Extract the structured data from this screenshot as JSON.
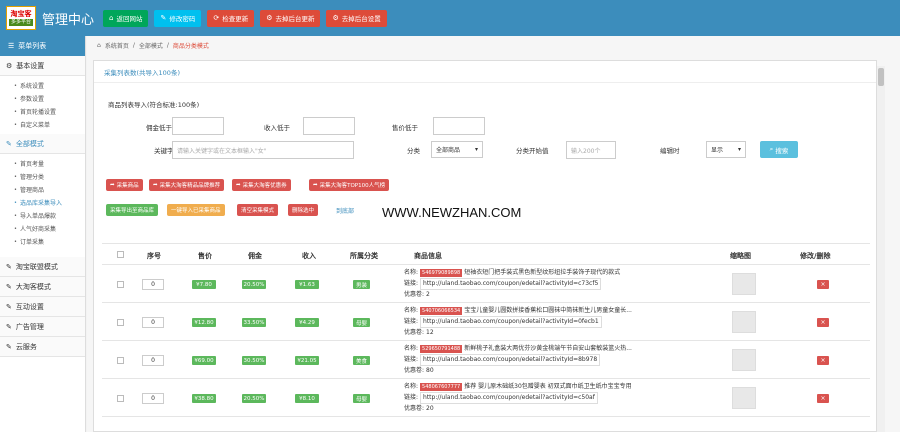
{
  "logo": {
    "line1": "淘宝客",
    "line2": "多多平台"
  },
  "header": {
    "title": "管理中心",
    "buttons": [
      {
        "label": "返回网站",
        "icon": "home-icon",
        "color": "#00a65a"
      },
      {
        "label": "修改密码",
        "icon": "pencil-icon",
        "color": "#00c0ef"
      },
      {
        "label": "检查更新",
        "icon": "refresh-icon",
        "color": "#dd4b39"
      },
      {
        "label": "去掉后台更新",
        "icon": "gear-icon",
        "color": "#dd4b39"
      },
      {
        "label": "去掉后台设置",
        "icon": "gear-icon",
        "color": "#dd4b39"
      }
    ]
  },
  "sidebar": {
    "head": "菜单列表",
    "sections": [
      {
        "label": "基本设置",
        "icon": "cog-icon",
        "items": [
          "系统设置",
          "参数设置",
          "首页轮播设置",
          "自定义菜单"
        ]
      },
      {
        "label": "全部模式",
        "icon": "edit-icon",
        "active": true,
        "items": [
          "首页考量",
          "管理分类",
          "管理商品",
          "选品库采集导入",
          "导入单品爆款",
          "人气好商采集",
          "订单采集"
        ]
      },
      {
        "label": "淘宝联盟模式",
        "icon": "edit-icon",
        "items": []
      },
      {
        "label": "大淘客模式",
        "icon": "edit-icon",
        "items": []
      },
      {
        "label": "互动设置",
        "icon": "edit-icon",
        "items": []
      },
      {
        "label": "广告管理",
        "icon": "edit-icon",
        "items": []
      },
      {
        "label": "云服务",
        "icon": "edit-icon",
        "items": []
      }
    ]
  },
  "breadcrumb": {
    "home": "系统首页",
    "mode": "全部模式",
    "current": "商品分类模式"
  },
  "panel": {
    "title": "采集列表数(共导入100条)"
  },
  "summary": "商品列表导入(符合标准:100条)",
  "filters": {
    "commission_label": "佣金低于",
    "income_label": "收入低于",
    "price_label": "售价低于",
    "keyword_label": "关键字",
    "keyword_placeholder": "请输入关键字或在文本框输入\"女\"",
    "category_label": "分类",
    "category_value": "全部商品",
    "order_label": "分类开始值",
    "order_placeholder": "输入200个",
    "sort_label": "编辑时",
    "sort_value": "显示",
    "search_label": "搜索"
  },
  "action_buttons": {
    "row1": [
      "采集商品",
      "采集大淘客精品品牌推荐",
      "采集大淘客优惠券",
      "采集大淘客TOP100人气榜"
    ],
    "row2_green": "采集导出至商品库",
    "row2_orange": "一键导入已采集商品",
    "row2_red1": "清空采集模式",
    "row2_red2": "删除选中",
    "link": "到底部"
  },
  "watermark": "WWW.NEWZHAN.COM",
  "table": {
    "headers": [
      "序号",
      "售价",
      "佣金",
      "收入",
      "所属分类",
      "商品信息",
      "缩略图",
      "修改/删除"
    ],
    "rows": [
      {
        "order": "0",
        "price": "¥7.80",
        "commission": "20.50%",
        "income": "¥1.63",
        "category": "男装",
        "name_label": "名称:",
        "id": "546979089898",
        "title": "短袖衣短门把手装式黑色新型纹形纽拉手装饰子现代的款式",
        "link_label": "链接:",
        "link": "http://uland.taobao.com/coupon/edetail?activityId=c73cf5",
        "coupon_label": "优惠卷:",
        "coupon": "2"
      },
      {
        "order": "0",
        "price": "¥12.80",
        "commission": "33.50%",
        "income": "¥4.29",
        "category": "母婴",
        "name_label": "名称:",
        "id": "540706066534",
        "title": "宝宝儿童婴儿圆数拼接香蕉松口圆袜中简袜新生儿男童女童长...",
        "link_label": "链接:",
        "link": "http://uland.taobao.com/coupon/edetail?activityId=0fecb1",
        "coupon_label": "优惠卷:",
        "coupon": "12"
      },
      {
        "order": "0",
        "price": "¥69.00",
        "commission": "30.50%",
        "income": "¥21.05",
        "category": "美食",
        "name_label": "名称:",
        "id": "529650791488",
        "title": "新鲜桃子礼盒装大两优芬沙黄金桃端午节自安山套敏装篮火热...",
        "link_label": "链接:",
        "link": "http://uland.taobao.com/coupon/edetail?activityId=8b978",
        "coupon_label": "优惠卷:",
        "coupon": "80"
      },
      {
        "order": "0",
        "price": "¥38.80",
        "commission": "20.50%",
        "income": "¥8.10",
        "category": "母婴",
        "name_label": "名称:",
        "id": "548067607777",
        "title": "推荐 婴儿原木础纸30包赠婴表 初双式面巾纸卫生纸巾宝宝专用",
        "link_label": "链接:",
        "link": "http://uland.taobao.com/coupon/edetail?activityId=c50af",
        "coupon_label": "优惠卷:",
        "coupon": "20"
      }
    ]
  }
}
